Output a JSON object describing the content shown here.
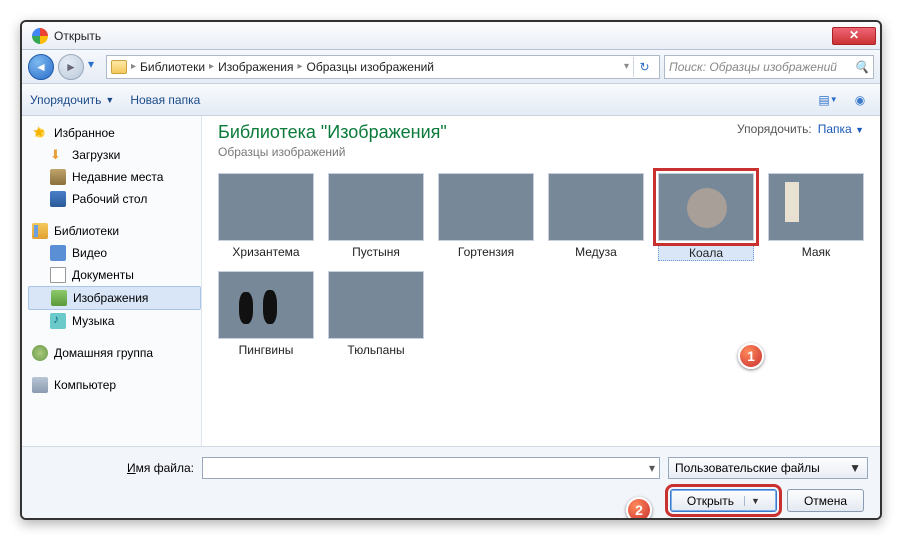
{
  "window": {
    "title": "Открыть"
  },
  "breadcrumb": {
    "root_icon": "folder",
    "items": [
      "Библиотеки",
      "Изображения",
      "Образцы изображений"
    ]
  },
  "search": {
    "placeholder": "Поиск: Образцы изображений"
  },
  "toolbar": {
    "organize": "Упорядочить",
    "newfolder": "Новая папка"
  },
  "sidebar": {
    "favorites": {
      "label": "Избранное",
      "items": [
        "Загрузки",
        "Недавние места",
        "Рабочий стол"
      ]
    },
    "libraries": {
      "label": "Библиотеки",
      "items": [
        "Видео",
        "Документы",
        "Изображения",
        "Музыка"
      ],
      "selected": 2
    },
    "homegroup": {
      "label": "Домашняя группа"
    },
    "computer": {
      "label": "Компьютер"
    }
  },
  "content": {
    "title": "Библиотека \"Изображения\"",
    "subtitle": "Образцы изображений",
    "arrange_label": "Упорядочить:",
    "arrange_value": "Папка",
    "thumbs": [
      {
        "name": "Хризантема",
        "cls": "p-chrys"
      },
      {
        "name": "Пустыня",
        "cls": "p-desert"
      },
      {
        "name": "Гортензия",
        "cls": "p-hydr"
      },
      {
        "name": "Медуза",
        "cls": "p-jelly"
      },
      {
        "name": "Коала",
        "cls": "p-koala",
        "selected": true
      },
      {
        "name": "Маяк",
        "cls": "p-light"
      },
      {
        "name": "Пингвины",
        "cls": "p-peng"
      },
      {
        "name": "Тюльпаны",
        "cls": "p-tulip"
      }
    ]
  },
  "footer": {
    "filename_label": "Имя файла:",
    "filename_value": "",
    "filter": "Пользовательские файлы",
    "open": "Открыть",
    "cancel": "Отмена"
  },
  "callouts": {
    "one": "1",
    "two": "2"
  }
}
